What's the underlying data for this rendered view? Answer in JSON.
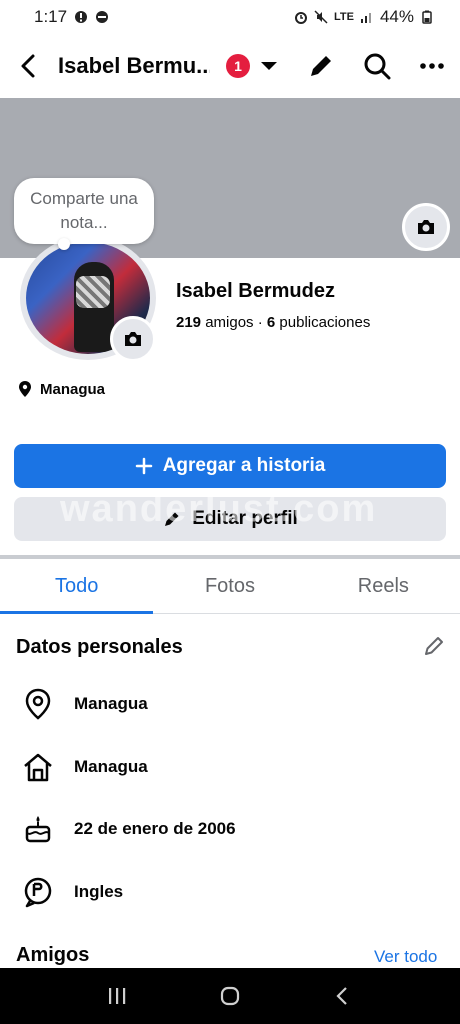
{
  "status_bar": {
    "time": "1:17",
    "network": "LTE",
    "battery": "44%"
  },
  "nav": {
    "title": "Isabel Bermu...",
    "notification_count": "1"
  },
  "note": {
    "placeholder": "Comparte una nota..."
  },
  "profile": {
    "name": "Isabel Bermudez",
    "friends_count": "219",
    "friends_label": "amigos",
    "separator": "·",
    "posts_count": "6",
    "posts_label": "publicaciones",
    "location": "Managua"
  },
  "actions": {
    "add_story": "Agregar a historia",
    "edit_profile": "Editar perfil"
  },
  "watermark": "wanderlust.com",
  "tabs": [
    {
      "label": "Todo",
      "active": true
    },
    {
      "label": "Fotos",
      "active": false
    },
    {
      "label": "Reels",
      "active": false
    }
  ],
  "personal_data": {
    "title": "Datos personales",
    "items": [
      {
        "icon": "location-pin-icon",
        "text": "Managua"
      },
      {
        "icon": "home-icon",
        "text": "Managua"
      },
      {
        "icon": "birthday-cake-icon",
        "text": "22 de enero de 2006"
      },
      {
        "icon": "language-icon",
        "text": "Ingles"
      }
    ]
  },
  "friends": {
    "title": "Amigos",
    "see_all": "Ver todo"
  },
  "colors": {
    "accent": "#1b74e4",
    "badge": "#e41e3f",
    "cover": "#a8abb1",
    "secondary_button": "#e4e6eb"
  }
}
